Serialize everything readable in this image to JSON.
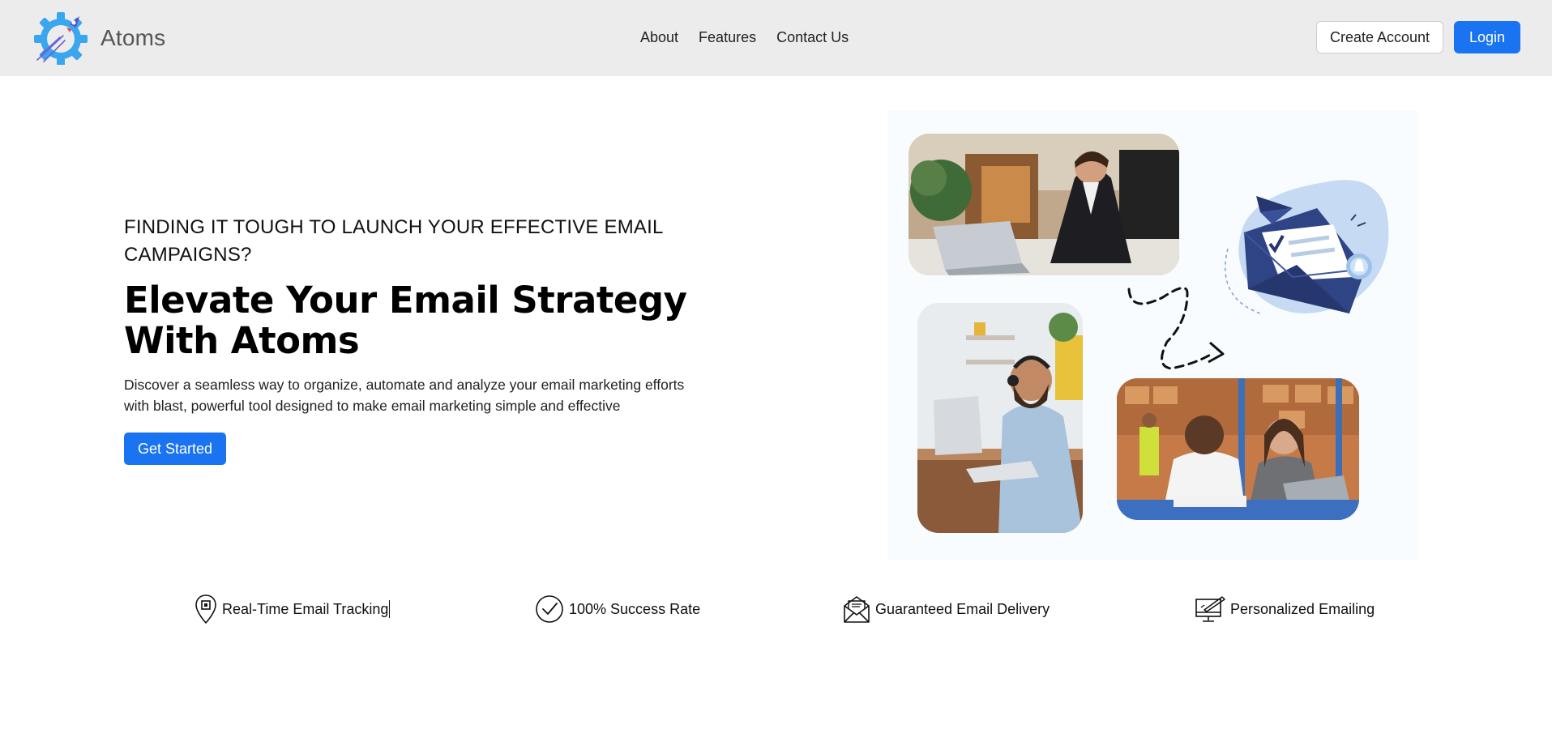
{
  "brand": {
    "name": "Atoms",
    "logo": "gear-rocket-logo"
  },
  "nav": {
    "links": [
      "About",
      "Features",
      "Contact Us"
    ]
  },
  "auth": {
    "create_account_label": "Create Account",
    "login_label": "Login"
  },
  "hero": {
    "eyebrow": "FINDING IT TOUGH TO LAUNCH YOUR EFFECTIVE EMAIL CAMPAIGNS?",
    "headline": "Elevate Your Email Strategy With Atoms",
    "lead": "Discover a seamless way to organize, automate and analyze your email marketing efforts with blast, powerful tool designed to make email marketing simple and effective",
    "cta_label": "Get Started"
  },
  "features": [
    {
      "label": "Real-Time Email Tracking",
      "icon": "location-pin-icon"
    },
    {
      "label": "100% Success Rate",
      "icon": "check-circle-icon"
    },
    {
      "label": "Guaranteed Email Delivery",
      "icon": "open-envelope-icon"
    },
    {
      "label": "Personalized Emailing",
      "icon": "monitor-pen-icon"
    }
  ],
  "colors": {
    "primary": "#1a73f0",
    "navbar_bg": "#ececec",
    "logo_blue": "#3aa6ee",
    "envelope_navy": "#26366e"
  }
}
